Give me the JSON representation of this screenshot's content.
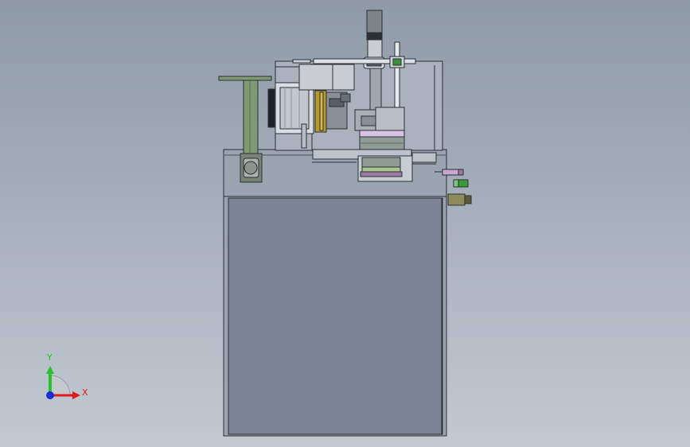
{
  "viewport": {
    "background_top": "#8f9aa8",
    "background_bottom": "#c2c9d2"
  },
  "triad": {
    "x_label": "X",
    "y_label": "Y",
    "x_color": "#e01b1b",
    "y_color": "#27c427",
    "z_color": "#1e2ad6"
  },
  "model": {
    "edge_color": "#2b2f36",
    "base_fill": "#7b8494",
    "column_color": "#7f9a72",
    "accent_yellow": "#b89a2a",
    "accent_purple": "#9a7aa0",
    "accent_green": "#3a9a3a"
  }
}
